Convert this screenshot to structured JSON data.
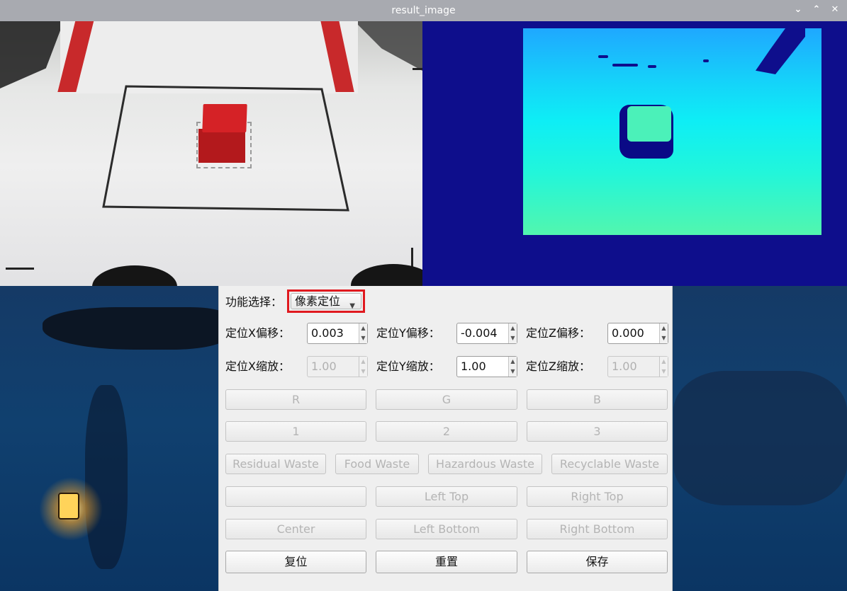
{
  "window": {
    "title": "result_image",
    "controls": [
      "⌄",
      "⌃",
      "✕"
    ]
  },
  "panel": {
    "function_label": "功能选择：",
    "function_value": "像素定位",
    "offset": {
      "x_label": "定位X偏移：",
      "x_value": "0.003",
      "y_label": "定位Y偏移：",
      "y_value": "-0.004",
      "z_label": "定位Z偏移：",
      "z_value": "0.000"
    },
    "scale": {
      "x_label": "定位X缩放：",
      "x_value": "1.00",
      "y_label": "定位Y缩放：",
      "y_value": "1.00",
      "z_label": "定位Z缩放：",
      "z_value": "1.00"
    },
    "color_buttons": [
      "R",
      "G",
      "B"
    ],
    "number_buttons": [
      "1",
      "2",
      "3"
    ],
    "waste_buttons": [
      "Residual Waste",
      "Food Waste",
      "Hazardous Waste",
      "Recyclable Waste"
    ],
    "corner_row1": [
      "",
      "Left Top",
      "Right Top"
    ],
    "corner_row2": [
      "Center",
      "Left Bottom",
      "Right Bottom"
    ],
    "action_buttons": [
      "复位",
      "重置",
      "保存"
    ]
  },
  "colors": {
    "highlight_border": "#e0191f",
    "depth_background": "#0e0e8c"
  }
}
